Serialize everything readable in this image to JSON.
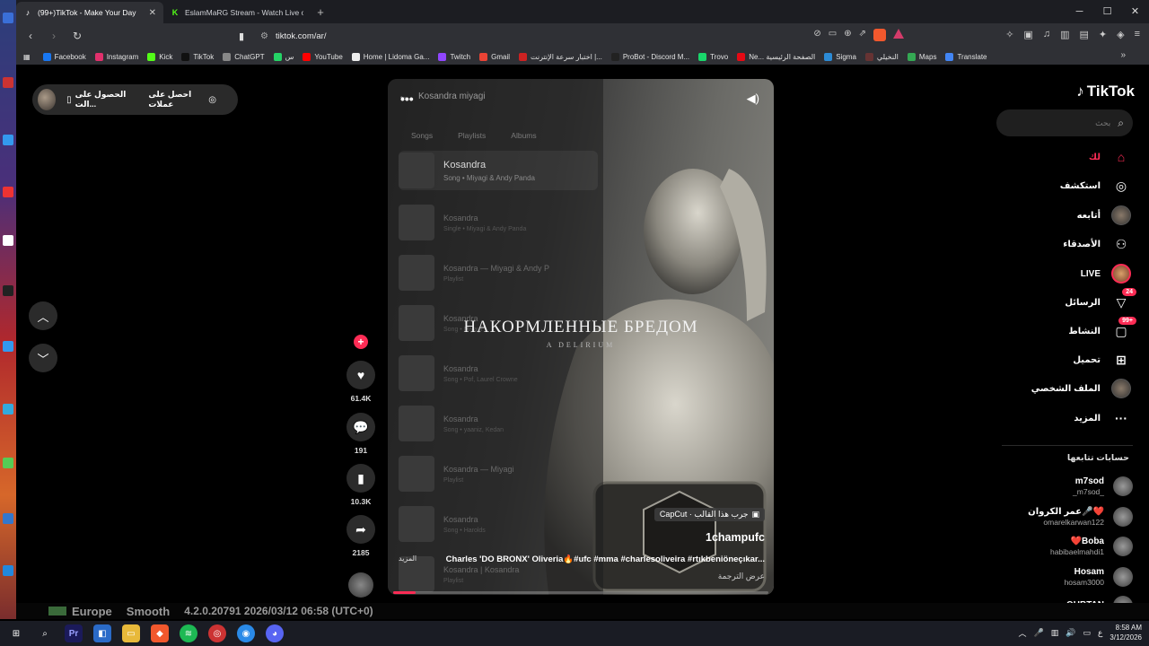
{
  "browser": {
    "tabs": [
      {
        "title": "(99+)TikTok - Make Your Day",
        "active": true
      },
      {
        "title": "EslamMaRG Stream - Watch Live on Kick",
        "active": false
      }
    ],
    "new_tab": "+",
    "url": "tiktok.com/ar/",
    "bookmarks": [
      {
        "label": "Facebook",
        "color": "#1877f2"
      },
      {
        "label": "Instagram",
        "color": "#e1306c"
      },
      {
        "label": "Kick",
        "color": "#53fc18"
      },
      {
        "label": "TikTok",
        "color": "#111111"
      },
      {
        "label": "ChatGPT",
        "color": "#888888"
      },
      {
        "label": "س",
        "color": "#25d366"
      },
      {
        "label": "YouTube",
        "color": "#ff0000"
      },
      {
        "label": "Home | Lidoma Ga...",
        "color": "#eeeeee"
      },
      {
        "label": "Twitch",
        "color": "#9146ff"
      },
      {
        "label": "Gmail",
        "color": "#ea4335"
      },
      {
        "label": "اختبار سرعة الإنترنت |...",
        "color": "#cc2222"
      },
      {
        "label": "ProBot - Discord M...",
        "color": "#222222"
      },
      {
        "label": "Trovo",
        "color": "#19d66b"
      },
      {
        "label": "Ne... الصفحة الرئيسية",
        "color": "#e50914"
      },
      {
        "label": "Sigma",
        "color": "#2c8bd6"
      },
      {
        "label": "النخيلي",
        "color": "#663333"
      },
      {
        "label": "Maps",
        "color": "#34a853"
      },
      {
        "label": "Translate",
        "color": "#4285f4"
      }
    ]
  },
  "coins_bar": {
    "get_coins": "احصل على عملات",
    "get_app": "الحصول على الت..."
  },
  "video": {
    "top_title": "Kosandra miyagi",
    "music_tabs": [
      "Songs",
      "Playlists",
      "Albums"
    ],
    "music_rows": [
      {
        "title": "Kosandra",
        "sub": "Song • Miyagi & Andy Panda",
        "highlight": true
      },
      {
        "title": "Kosandra",
        "sub": "Single • Miyagi & Andy Panda",
        "highlight": false
      },
      {
        "title": "Kosandra — Miyagi & Andy P",
        "sub": "Playlist",
        "highlight": false
      },
      {
        "title": "Kosandra",
        "sub": "Song • Miyagi",
        "highlight": false
      },
      {
        "title": "Kosandra",
        "sub": "Song • Pof, Laurel Crowne",
        "highlight": false
      },
      {
        "title": "Kosandra",
        "sub": "Song • yaaniz, Kedan",
        "highlight": false
      },
      {
        "title": "Kosandra — Miyagi",
        "sub": "Playlist",
        "highlight": false
      },
      {
        "title": "Kosandra",
        "sub": "Song • Harolds",
        "highlight": false
      },
      {
        "title": "Kosandra | Kosandra",
        "sub": "Playlist",
        "highlight": false
      }
    ],
    "overlay_title": "НАКОРМЛЕННЫЕ БРЕДОМ",
    "overlay_subtitle": "A DELIRIUM",
    "capcut_label": "CapCut · جرب هذا القالب",
    "author": "1champufc",
    "caption": "Charles 'DO BRONX' Oliveria🔥#ufc #mma #charlesoliveira #rtıkbeniöneçıkar...",
    "more_label": "المزيد",
    "translate_label": "عرض الترجمة",
    "progress": 0.06
  },
  "actions": {
    "likes": "61.4K",
    "comments": "191",
    "saves": "10.3K",
    "shares": "2185"
  },
  "sidebar": {
    "logo": "TikTok",
    "search_placeholder": "بحث",
    "nav": [
      {
        "label": "لك",
        "icon": "home-icon"
      },
      {
        "label": "استكشف",
        "icon": "compass-icon"
      },
      {
        "label": "أتابعه",
        "icon": "avatar"
      },
      {
        "label": "الأصدقاء",
        "icon": "friends-icon"
      },
      {
        "label": "LIVE",
        "icon": "live-avatar"
      },
      {
        "label": "الرسائل",
        "icon": "messages-icon",
        "badge": "24"
      },
      {
        "label": "النشاط",
        "icon": "activity-icon",
        "badge": "99+"
      },
      {
        "label": "تحميل",
        "icon": "upload-icon"
      },
      {
        "label": "الملف الشخصي",
        "icon": "avatar"
      },
      {
        "label": "المزيد",
        "icon": "more-icon"
      }
    ],
    "following_header": "حسابات تتابعها",
    "accounts": [
      {
        "name": "m7sod",
        "handle": "_m7sod_"
      },
      {
        "name": "عمر الكروان🎤❤️",
        "handle": "omarelkarwan122"
      },
      {
        "name": "❤️Boba",
        "handle": "habibaelmahdi1"
      },
      {
        "name": "Hosam",
        "handle": "hosam3000"
      },
      {
        "name": "QUBTAN",
        "handle": ""
      }
    ]
  },
  "game_strip": [
    "Europe",
    "Smooth",
    "4.2.0.20791 2026/03/12 06:58 (UTC+0)"
  ],
  "taskbar": {
    "time": "8:58 AM",
    "date": "3/12/2026",
    "lang": "ع"
  }
}
